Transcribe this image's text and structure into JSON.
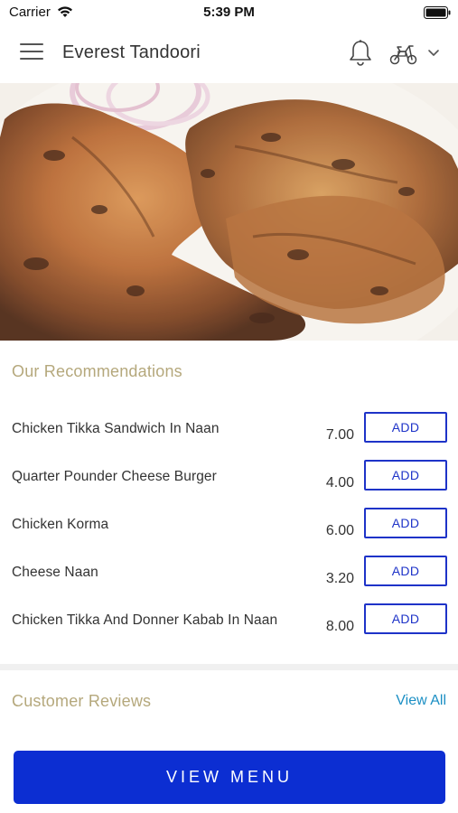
{
  "status_bar": {
    "carrier": "Carrier",
    "time": "5:39 PM"
  },
  "header": {
    "title": "Everest Tandoori"
  },
  "recommendations": {
    "title": "Our Recommendations",
    "add_label": "ADD",
    "items": [
      {
        "name": "Chicken Tikka Sandwich In Naan",
        "price": "7.00"
      },
      {
        "name": "Quarter Pounder Cheese Burger",
        "price": "4.00"
      },
      {
        "name": "Chicken Korma",
        "price": "6.00"
      },
      {
        "name": "Cheese Naan",
        "price": "3.20"
      },
      {
        "name": "Chicken Tikka And Donner Kabab In Naan",
        "price": "8.00"
      }
    ]
  },
  "reviews": {
    "title": "Customer Reviews",
    "view_all": "View All"
  },
  "footer": {
    "view_menu": "VIEW MENU"
  },
  "colors": {
    "accent_blue": "#0c2ed2",
    "section_title": "#b5a87c",
    "link": "#1b8fc4"
  }
}
